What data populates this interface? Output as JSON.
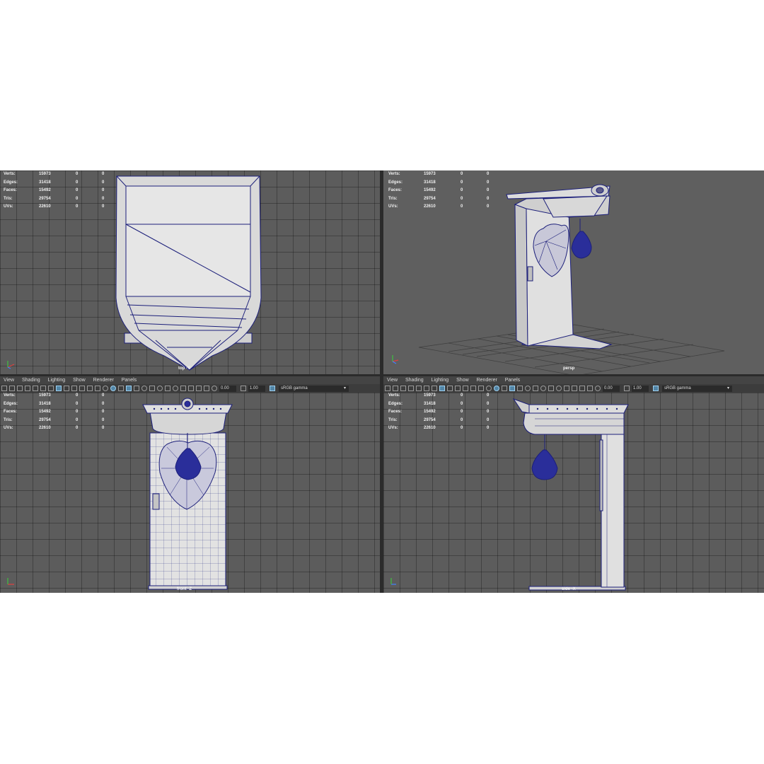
{
  "hud": {
    "labels": {
      "verts": "Verts:",
      "edges": "Edges:",
      "faces": "Faces:",
      "tris": "Tris:",
      "uvs": "UVs:"
    },
    "values": {
      "verts": "15973",
      "edges": "31418",
      "faces": "15492",
      "tris": "29754",
      "uvs": "22610"
    },
    "zero": "0"
  },
  "menu": {
    "view": "View",
    "shading": "Shading",
    "lighting": "Lighting",
    "show": "Show",
    "renderer": "Renderer",
    "panels": "Panels"
  },
  "toolbar": {
    "exposure": "0.00",
    "gamma": "1.00",
    "colorspace": "sRGB gamma"
  },
  "cameras": {
    "top": "top -Y",
    "persp": "persp",
    "front": "front -Z",
    "side": "side -X"
  },
  "icons": [
    "select-camera-icon",
    "lock-camera-icon",
    "bookmark-icon",
    "image-plane-icon",
    "2d-pan-zoom-icon",
    "grease-pencil-icon",
    "grid-icon",
    "film-gate-icon",
    "resolution-gate-icon",
    "gate-mask-icon",
    "field-chart-icon",
    "safe-action-icon",
    "safe-title-icon",
    "wireframe-icon",
    "smooth-shade-icon",
    "default-material-icon",
    "wireframe-on-shaded-icon",
    "textured-icon",
    "lights-icon",
    "shadows-icon",
    "ambient-occlusion-icon",
    "motion-blur-icon",
    "anti-aliasing-icon",
    "isolate-select-icon",
    "xray-icon",
    "xray-joints-icon",
    "backface-culling-icon",
    "exposure-icon",
    "gamma-icon",
    "color-management-icon"
  ],
  "colors": {
    "viewport_bg": "#5c5c5c",
    "wire": "#1c1f7a",
    "mesh": "#dcdcdc",
    "active_icon": "#5285a6"
  }
}
